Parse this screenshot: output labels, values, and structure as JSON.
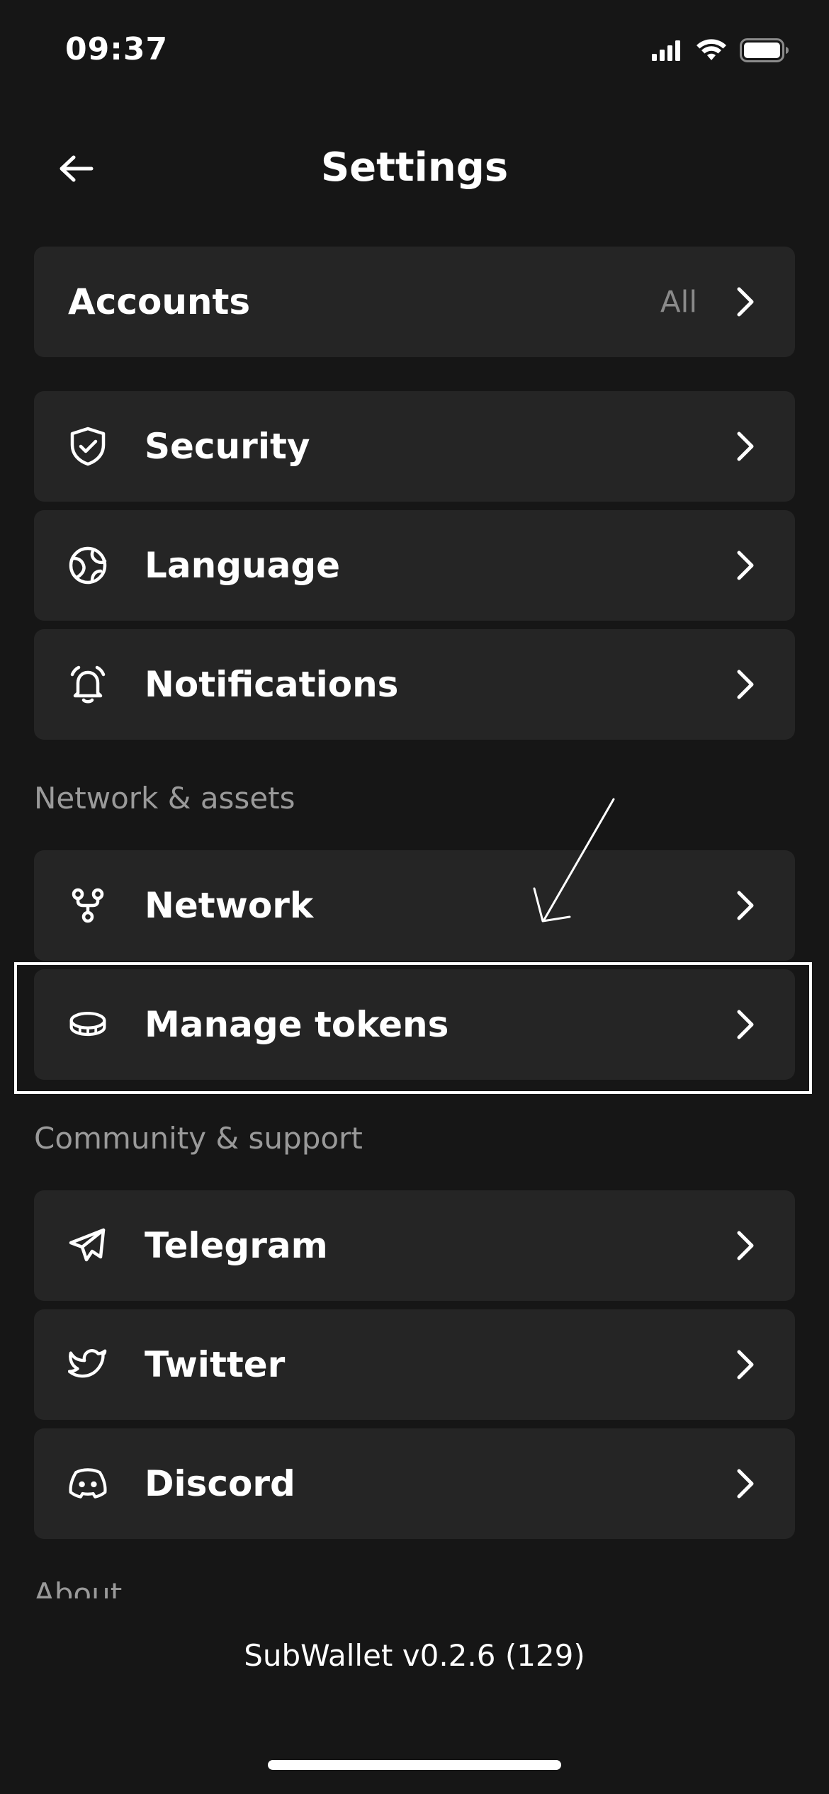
{
  "status_bar": {
    "time": "09:37"
  },
  "header": {
    "title": "Settings"
  },
  "accounts": {
    "label": "Accounts",
    "value": "All"
  },
  "general_items": [
    {
      "label": "Security",
      "icon": "shield-icon"
    },
    {
      "label": "Language",
      "icon": "globe-icon"
    },
    {
      "label": "Notifications",
      "icon": "bell-icon"
    }
  ],
  "network_section": {
    "title": "Network & assets",
    "items": [
      {
        "label": "Network",
        "icon": "network-icon"
      },
      {
        "label": "Manage tokens",
        "icon": "coins-icon"
      }
    ]
  },
  "community_section": {
    "title": "Community & support",
    "items": [
      {
        "label": "Telegram",
        "icon": "telegram-icon"
      },
      {
        "label": "Twitter",
        "icon": "twitter-icon"
      },
      {
        "label": "Discord",
        "icon": "discord-icon"
      }
    ]
  },
  "about_section": {
    "title": "About"
  },
  "footer": {
    "version": "SubWallet v0.2.6 (129)"
  },
  "colors": {
    "background": "#161616",
    "card": "#252525",
    "muted_text": "#9a9a9a",
    "annotation": "#ffffff"
  }
}
